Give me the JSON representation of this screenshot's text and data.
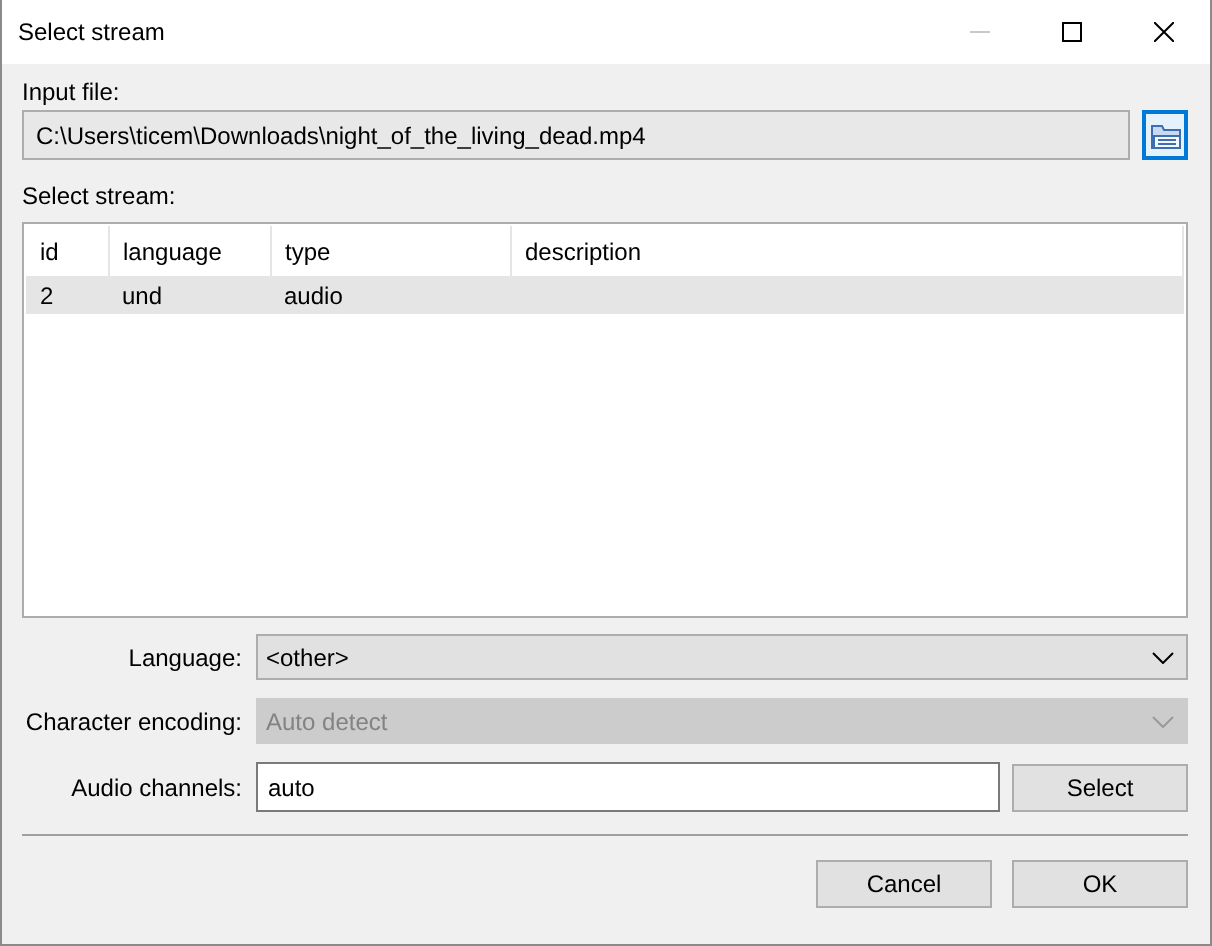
{
  "window": {
    "title": "Select stream"
  },
  "input_file": {
    "label": "Input file:",
    "value": "C:\\Users\\ticem\\Downloads\\night_of_the_living_dead.mp4"
  },
  "stream_list": {
    "label": "Select stream:",
    "columns": [
      "id",
      "language",
      "type",
      "description"
    ],
    "rows": [
      {
        "cells": [
          "2",
          "und",
          "audio"
        ],
        "selected": true
      }
    ]
  },
  "fields": [
    {
      "kind": "combo",
      "label": "Language:",
      "value": "<other>",
      "disabled": false
    },
    {
      "kind": "combo",
      "label": "Character encoding:",
      "value": "Auto detect",
      "disabled": true
    },
    {
      "kind": "text",
      "label": "Audio channels:",
      "value": "auto",
      "button": "Select"
    }
  ],
  "buttons": [
    "Cancel",
    "OK"
  ]
}
